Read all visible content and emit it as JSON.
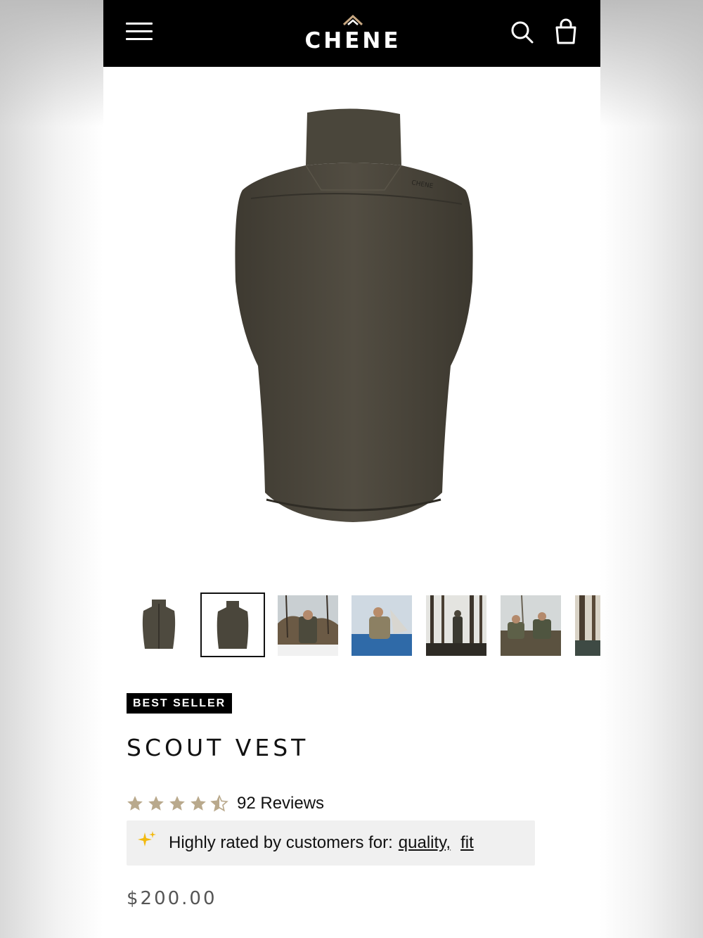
{
  "header": {
    "brand": "CHENE"
  },
  "product": {
    "badge": "BEST SELLER",
    "title": "SCOUT VEST",
    "rating": 4.5,
    "rating_max": 5,
    "reviews": "92 Reviews",
    "highlight_prefix": "Highly rated by customers for:",
    "highlight_tags": [
      "quality,",
      "fit"
    ],
    "price": "$200.00"
  },
  "gallery": {
    "selected_index": 1,
    "thumbnails": [
      "vest-front",
      "vest-back",
      "hunter-blind",
      "hunter-boat",
      "swamp-hunter",
      "duck-hunters",
      "swamp-trees"
    ]
  },
  "colors": {
    "header_bg": "#000000",
    "star": "#b9a98c",
    "vest": "#4a463c",
    "highlight_bg": "#f0f0f0"
  },
  "icons": [
    "menu-icon",
    "logo-mark-icon",
    "search-icon",
    "cart-bag-icon",
    "star-icon",
    "sparkle-icon"
  ]
}
